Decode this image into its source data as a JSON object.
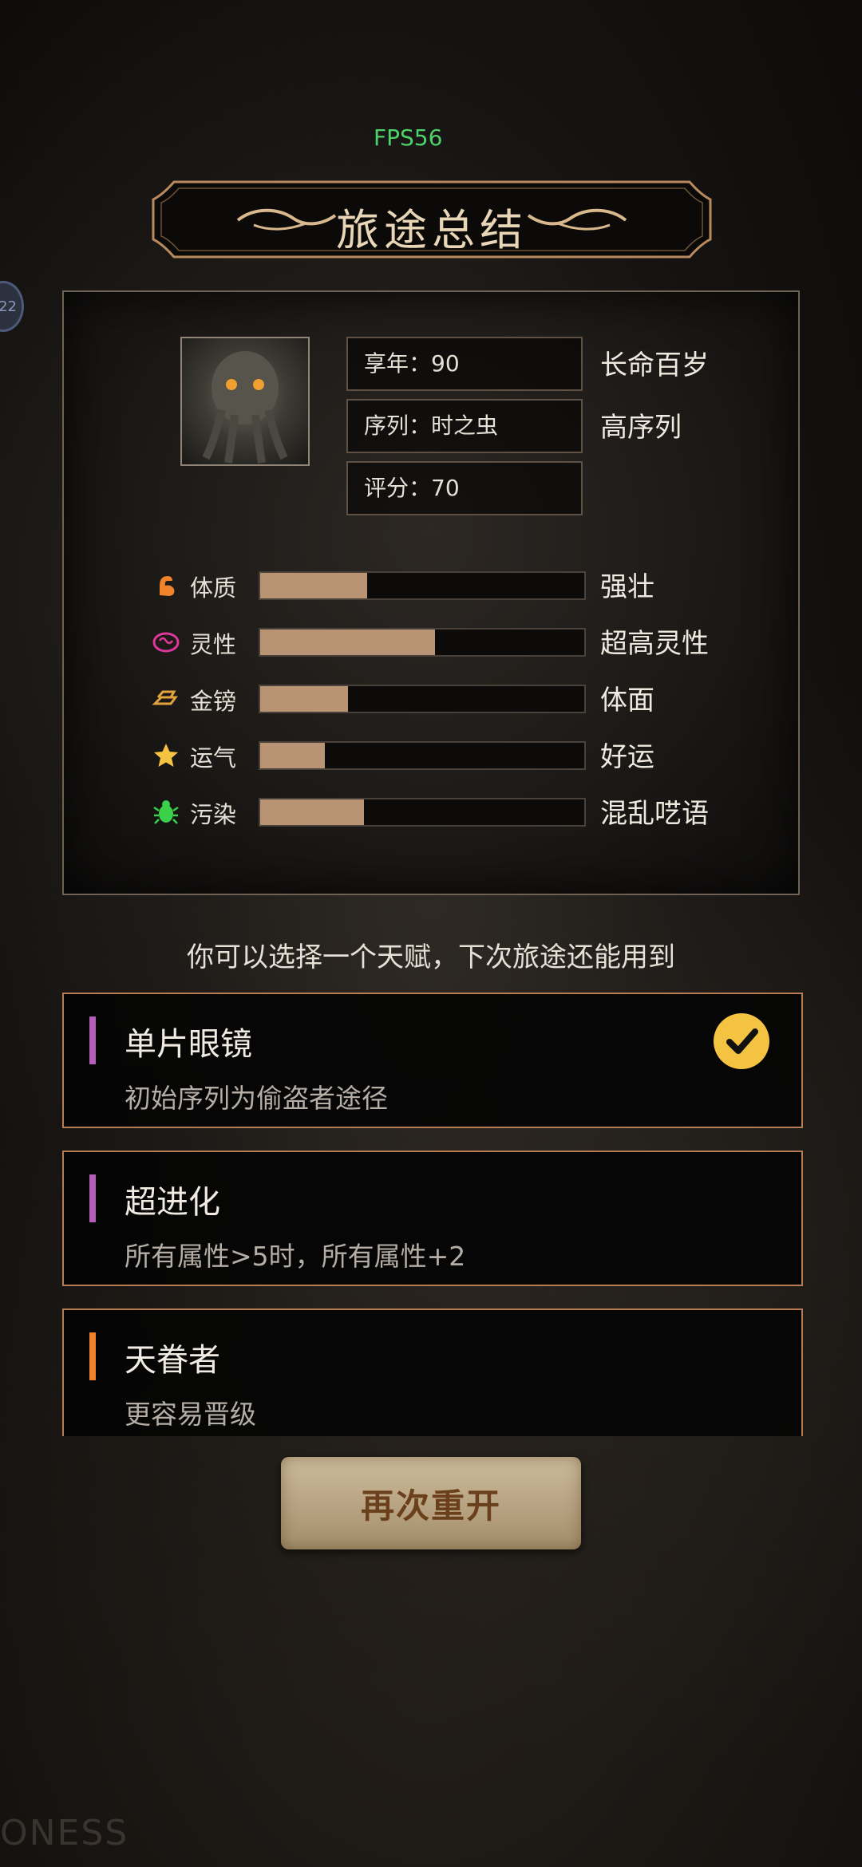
{
  "fps_label": "FPS56",
  "side_badge": "22",
  "title": "旅途总结",
  "summary": {
    "info": [
      {
        "label": "享年：90",
        "tag": "长命百岁"
      },
      {
        "label": "序列：时之虫",
        "tag": "高序列"
      },
      {
        "label": "评分：70",
        "tag": ""
      }
    ],
    "stats": [
      {
        "icon": "arm-icon",
        "color": "#f0832c",
        "label": "体质",
        "fill": 0.33,
        "tag": "强壮"
      },
      {
        "icon": "brain-icon",
        "color": "#e0389a",
        "label": "灵性",
        "fill": 0.54,
        "tag": "超高灵性"
      },
      {
        "icon": "gold-bars-icon",
        "color": "#e3a33c",
        "label": "金镑",
        "fill": 0.27,
        "tag": "体面"
      },
      {
        "icon": "star-icon",
        "color": "#f3c341",
        "label": "运气",
        "fill": 0.2,
        "tag": "好运"
      },
      {
        "icon": "bug-icon",
        "color": "#3bd04a",
        "label": "污染",
        "fill": 0.32,
        "tag": "混乱呓语"
      }
    ]
  },
  "hint": "你可以选择一个天赋，下次旅途还能用到",
  "talents": [
    {
      "name": "单片眼镜",
      "desc": "初始序列为偷盗者途径",
      "accent": "#b45fb7",
      "selected": true
    },
    {
      "name": "超进化",
      "desc": "所有属性>5时，所有属性+2",
      "accent": "#b45fb7",
      "selected": false
    },
    {
      "name": "天眷者",
      "desc": "更容易晋级",
      "accent": "#f0832c",
      "selected": false
    }
  ],
  "restart_button": "再次重开",
  "watermark": "ONESS"
}
